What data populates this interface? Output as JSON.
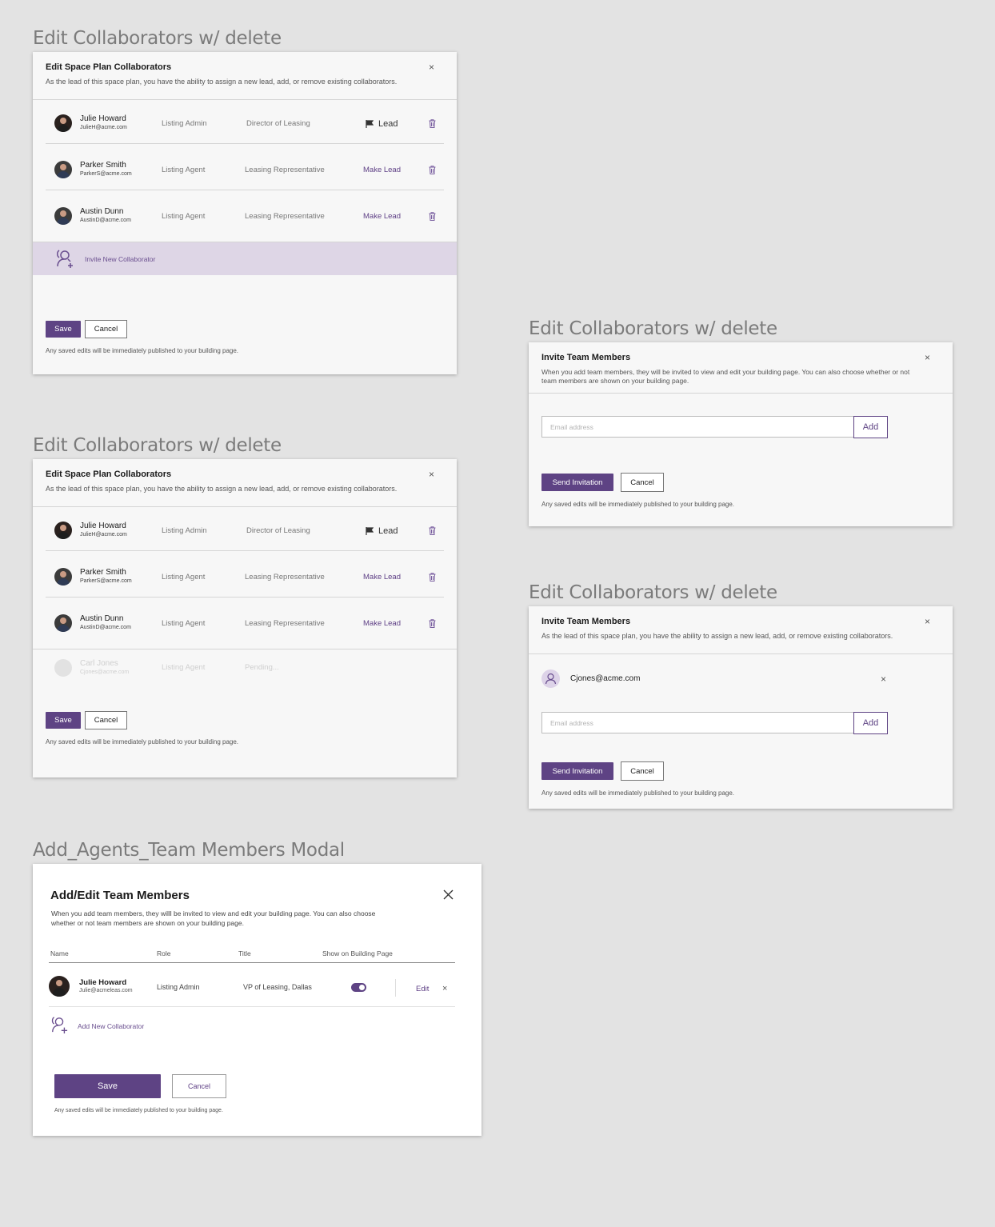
{
  "frames": {
    "f1": "Edit Collaborators w/ delete",
    "f2": "Edit Collaborators w/ delete",
    "f3": "Edit Collaborators w/ delete",
    "f4": "Edit Collaborators w/ delete",
    "f5": "Add_Agents_Team Members Modal"
  },
  "edit_modal": {
    "title": "Edit Space Plan Collaborators",
    "subtitle": "As the lead of this space plan, you have the ability to assign a new lead, add, or remove existing collaborators.",
    "close": "×",
    "rows": [
      {
        "name": "Julie Howard",
        "email": "JulieH@acme.com",
        "role": "Listing Admin",
        "title": "Director of Leasing",
        "action": "Lead"
      },
      {
        "name": "Parker Smith",
        "email": "ParkerS@acme.com",
        "role": "Listing Agent",
        "title": "Leasing Representative",
        "action": "Make Lead"
      },
      {
        "name": "Austin Dunn",
        "email": "AustinD@acme.com",
        "role": "Listing Agent",
        "title": "Leasing Representative",
        "action": "Make Lead"
      }
    ],
    "pending": {
      "name": "Carl Jones",
      "email": "Cjones@acme.com",
      "role": "Listing Agent",
      "status": "Pending..."
    },
    "invite_label": "Invite New Collaborator",
    "save": "Save",
    "cancel": "Cancel",
    "note": "Any saved edits will be immediately published to your building page."
  },
  "invite_modal_a": {
    "title": "Invite Team Members",
    "subtitle": "When you add team members, they will be invited to view and edit your building page. You can also choose whether or not team members are shown on your building page.",
    "close": "×",
    "email_placeholder": "Email address",
    "add": "Add",
    "send": "Send Invitation",
    "cancel": "Cancel",
    "note": "Any saved edits will be immediately published to your building page."
  },
  "invite_modal_b": {
    "title": "Invite Team Members",
    "subtitle": "As the lead of this space plan, you have the ability to assign a new lead, add, or remove existing collaborators.",
    "close": "×",
    "invited_email": "Cjones@acme.com",
    "remove": "×",
    "email_placeholder": "Email address",
    "add": "Add",
    "send": "Send Invitation",
    "cancel": "Cancel",
    "note": "Any saved edits will be immediately published to your building page."
  },
  "team_modal": {
    "title": "Add/Edit Team Members",
    "subtitle": "When you add team members, they willl be invited to view and edit your building page. You can also choose whether or not team members are shown on your building page.",
    "close": "×",
    "columns": [
      "Name",
      "Role",
      "Title",
      "Show on Building Page"
    ],
    "member": {
      "name": "Julie Howard",
      "email": "Julie@acmeleas.com",
      "role": "Listing Admin",
      "title": "VP of Leasing, Dallas",
      "show": true,
      "edit": "Edit",
      "remove": "×"
    },
    "add_label": "Add New Collaborator",
    "save": "Save",
    "cancel": "Cancel",
    "note": "Any saved edits will be immediately published to your building page."
  },
  "colors": {
    "accent": "#5e4384",
    "invite_band": "#ded6e6",
    "background": "#e3e3e3"
  },
  "icons": [
    "close-icon",
    "flag-icon",
    "trash-icon",
    "add-user-icon",
    "user-icon"
  ]
}
